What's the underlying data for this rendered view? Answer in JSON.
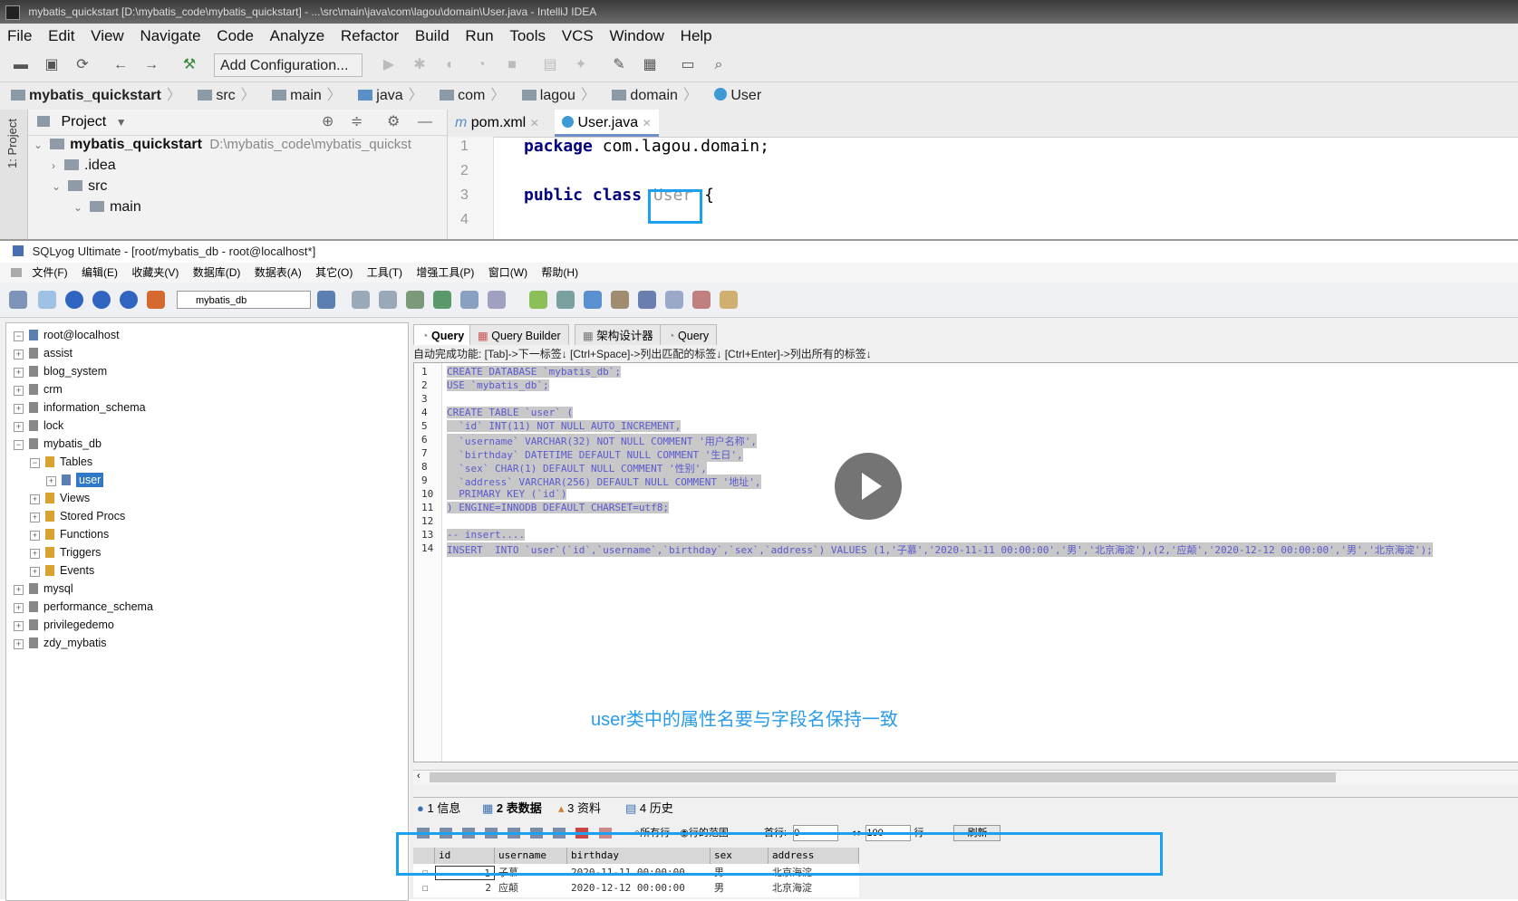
{
  "ij": {
    "title": "mybatis_quickstart [D:\\mybatis_code\\mybatis_quickstart] - ...\\src\\main\\java\\com\\lagou\\domain\\User.java - IntelliJ IDEA",
    "menu": [
      "File",
      "Edit",
      "View",
      "Navigate",
      "Code",
      "Analyze",
      "Refactor",
      "Build",
      "Run",
      "Tools",
      "VCS",
      "Window",
      "Help"
    ],
    "add_config": "Add Configuration...",
    "breadcrumbs": [
      "mybatis_quickstart",
      "src",
      "main",
      "java",
      "com",
      "lagou",
      "domain",
      "User"
    ],
    "project_label": "Project",
    "side_label": "1: Project",
    "tree": [
      {
        "name": "mybatis_quickstart",
        "path": "D:\\mybatis_code\\mybatis_quickst"
      },
      {
        "name": ".idea"
      },
      {
        "name": "src"
      },
      {
        "name": "main"
      }
    ],
    "tabs": [
      "pom.xml",
      "User.java"
    ],
    "lines": [
      "1",
      "2",
      "3",
      "4"
    ],
    "code": {
      "pkg_kw": "package",
      "pkg_rest": " com.lagou.domain;",
      "pub": "public class",
      "cls": "User",
      "brace": " {"
    }
  },
  "sy": {
    "title": "SQLyog Ultimate - [root/mybatis_db - root@localhost*]",
    "menu": [
      "文件(F)",
      "编辑(E)",
      "收藏夹(V)",
      "数据库(D)",
      "数据表(A)",
      "其它(O)",
      "工具(T)",
      "增强工具(P)",
      "窗口(W)",
      "帮助(H)"
    ],
    "db_select": "mybatis_db",
    "tree": {
      "root": "root@localhost",
      "dbs": [
        "assist",
        "blog_system",
        "crm",
        "information_schema",
        "lock",
        "mybatis_db"
      ],
      "tables": "Tables",
      "user": "user",
      "sub": [
        "Views",
        "Stored Procs",
        "Functions",
        "Triggers",
        "Events"
      ],
      "more": [
        "mysql",
        "performance_schema",
        "privilegedemo",
        "zdy_mybatis"
      ]
    },
    "qtabs": [
      "Query",
      "Query Builder",
      "架构设计器",
      "Query"
    ],
    "autocomp": "自动完成功能: [Tab]->下一标签↓ [Ctrl+Space]->列出匹配的标签↓ [Ctrl+Enter]->列出所有的标签↓",
    "sql": [
      "CREATE DATABASE `mybatis_db`;",
      "USE `mybatis_db`;",
      "",
      "CREATE TABLE `user` (",
      "  `id` INT(11) NOT NULL AUTO_INCREMENT,",
      "  `username` VARCHAR(32) NOT NULL COMMENT '用户名称',",
      "  `birthday` DATETIME DEFAULT NULL COMMENT '生日',",
      "  `sex` CHAR(1) DEFAULT NULL COMMENT '性别',",
      "  `address` VARCHAR(256) DEFAULT NULL COMMENT '地址',",
      "  PRIMARY KEY (`id`)",
      ") ENGINE=INNODB DEFAULT CHARSET=utf8;",
      "",
      "-- insert....",
      "INSERT  INTO `user`(`id`,`username`,`birthday`,`sex`,`address`) VALUES (1,'子慕','2020-11-11 00:00:00','男','北京海淀'),(2,'应颠','2020-12-12 00:00:00','男','北京海淀');"
    ],
    "caption": "user类中的属性名要与字段名保持一致",
    "rtabs": [
      "1 信息",
      "2 表数据",
      "3 资料",
      "4 历史"
    ],
    "res_tool": {
      "all": "所有行",
      "range": "行的范围",
      "first_label": "首行:",
      "first": "0",
      "count": "100",
      "rows": "行",
      "refresh": "刷新"
    },
    "grid": {
      "headers": [
        "id",
        "username",
        "birthday",
        "sex",
        "address"
      ],
      "rows": [
        [
          "1",
          "子慕",
          "2020-11-11 00:00:00",
          "男",
          "北京海淀"
        ],
        [
          "2",
          "应颠",
          "2020-12-12 00:00:00",
          "男",
          "北京海淀"
        ]
      ]
    }
  }
}
